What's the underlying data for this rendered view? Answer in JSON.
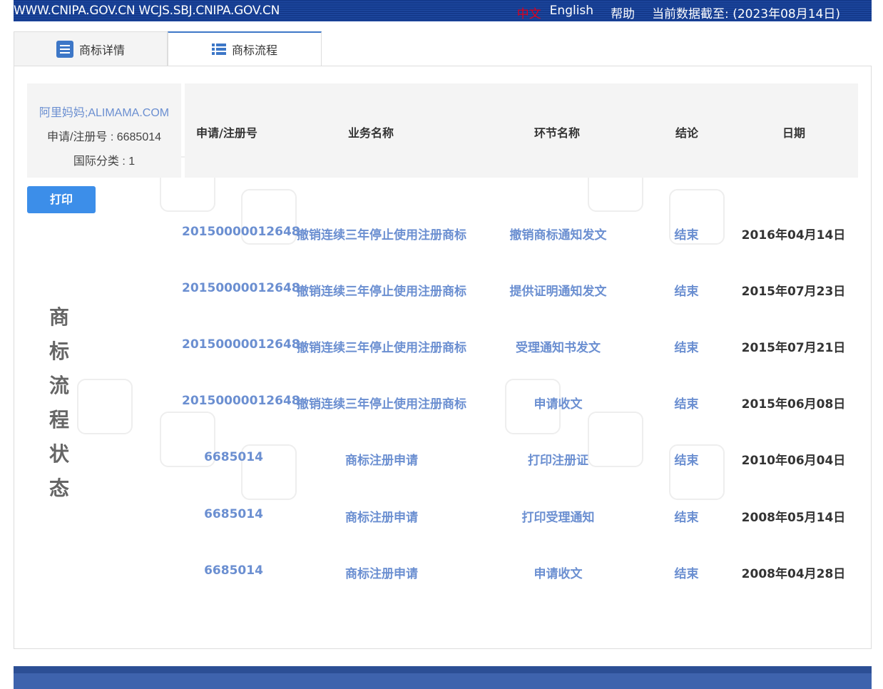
{
  "topbar": {
    "site": "WWW.CNIPA.GOV.CN WCJS.SBJ.CNIPA.GOV.CN",
    "lang_zh": "中文",
    "lang_en": "English",
    "help": "帮助",
    "data_date": "当前数据截至: (2023年08月14日)"
  },
  "tabs": [
    {
      "label": "商标详情",
      "icon": "document-list-icon",
      "active": false
    },
    {
      "label": "商标流程",
      "icon": "list-icon",
      "active": true
    }
  ],
  "info": {
    "name": "阿里妈妈;ALIMAMA.COM",
    "reg_no": "申请/注册号 : 6685014",
    "int_class": "国际分类 : 1"
  },
  "print_label": "打印",
  "side_label": [
    "商",
    "标",
    "流",
    "程",
    "状",
    "态"
  ],
  "table": {
    "headers": [
      "申请/注册号",
      "业务名称",
      "环节名称",
      "结论",
      "日期"
    ],
    "rows": [
      {
        "no": "20150000012648",
        "business": "撤销连续三年停止使用注册商标",
        "step": "撤销商标通知发文",
        "result": "结束",
        "date": "2016年04月14日"
      },
      {
        "no": "20150000012648",
        "business": "撤销连续三年停止使用注册商标",
        "step": "提供证明通知发文",
        "result": "结束",
        "date": "2015年07月23日"
      },
      {
        "no": "20150000012648",
        "business": "撤销连续三年停止使用注册商标",
        "step": "受理通知书发文",
        "result": "结束",
        "date": "2015年07月21日"
      },
      {
        "no": "20150000012648",
        "business": "撤销连续三年停止使用注册商标",
        "step": "申请收文",
        "result": "结束",
        "date": "2015年06月08日"
      },
      {
        "no": "6685014",
        "business": "商标注册申请",
        "step": "打印注册证",
        "result": "结束",
        "date": "2010年06月04日"
      },
      {
        "no": "6685014",
        "business": "商标注册申请",
        "step": "打印受理通知",
        "result": "结束",
        "date": "2008年05月14日"
      },
      {
        "no": "6685014",
        "business": "商标注册申请",
        "step": "申请收文",
        "result": "结束",
        "date": "2008年04月28日"
      }
    ]
  },
  "colors": {
    "topbar": "#143a8c",
    "link": "#6b8fd1",
    "accent": "#3c8ee9",
    "lang_active": "#e0001b",
    "footer": "#3e63ad"
  }
}
